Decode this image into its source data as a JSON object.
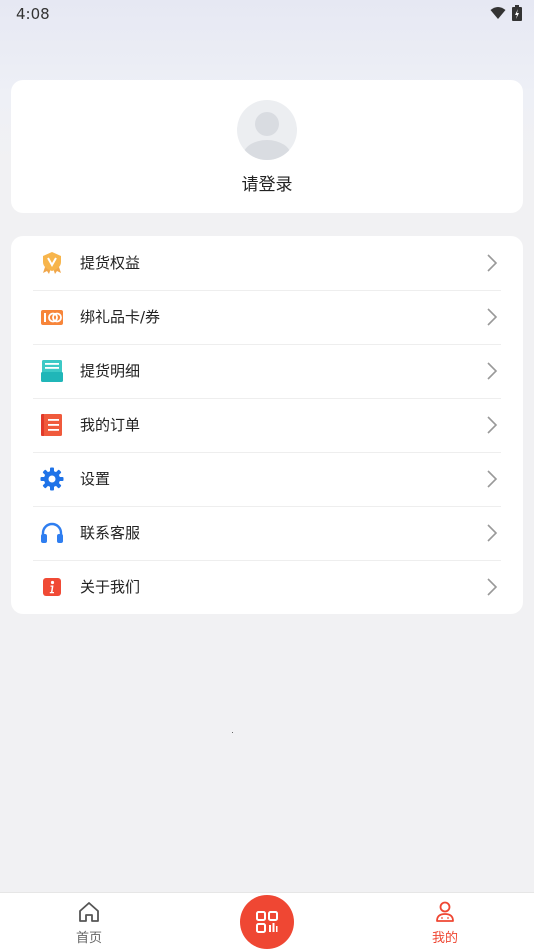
{
  "status_bar": {
    "time": "4:08"
  },
  "profile": {
    "login_text": "请登录"
  },
  "menu": {
    "items": [
      {
        "label": "提货权益",
        "icon": "medal-icon"
      },
      {
        "label": "绑礼品卡/券",
        "icon": "gift-card-icon"
      },
      {
        "label": "提货明细",
        "icon": "tray-icon"
      },
      {
        "label": "我的订单",
        "icon": "order-list-icon"
      },
      {
        "label": "设置",
        "icon": "gear-icon"
      },
      {
        "label": "联系客服",
        "icon": "headphones-icon"
      },
      {
        "label": "关于我们",
        "icon": "info-icon"
      }
    ]
  },
  "bottom_nav": {
    "home_label": "首页",
    "mine_label": "我的",
    "center_icon": "qr-scan-icon"
  },
  "colors": {
    "accent": "#ef4733",
    "inactive": "#666666"
  }
}
